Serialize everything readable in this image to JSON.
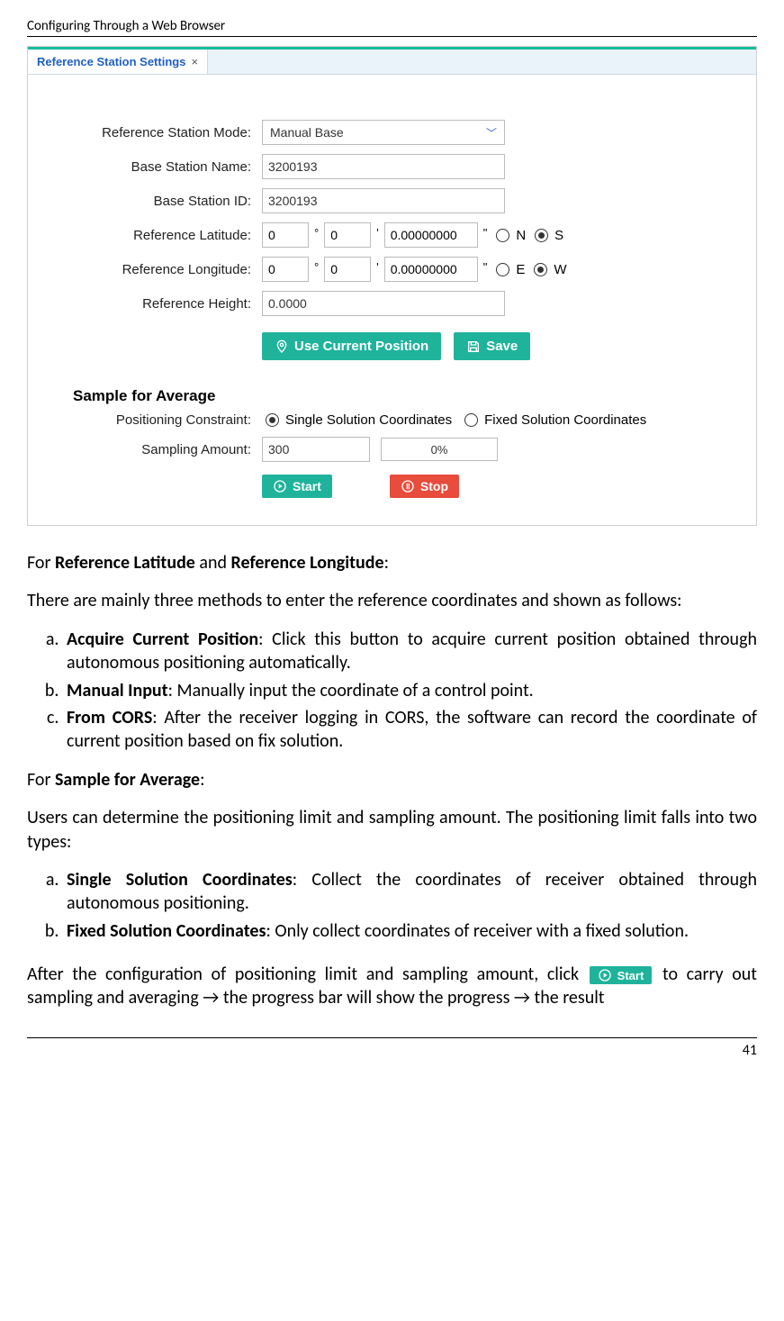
{
  "header": "Configuring Through a Web Browser",
  "page_number": "41",
  "screenshot": {
    "tab_label": "Reference Station Settings",
    "labels": {
      "mode": "Reference Station Mode:",
      "name": "Base Station Name:",
      "id": "Base Station ID:",
      "lat": "Reference Latitude:",
      "lon": "Reference Longitude:",
      "height": "Reference Height:",
      "constraint": "Positioning Constraint:",
      "amount": "Sampling Amount:"
    },
    "values": {
      "mode": "Manual Base",
      "name": "3200193",
      "id": "3200193",
      "lat_d": "0",
      "lat_m": "0",
      "lat_s": "0.00000000",
      "lon_d": "0",
      "lon_m": "0",
      "lon_s": "0.00000000",
      "height": "0.0000",
      "amount": "300",
      "progress": "0%"
    },
    "dir": {
      "n": "N",
      "s": "S",
      "e": "E",
      "w": "W"
    },
    "section_heading": "Sample for Average",
    "radios": {
      "single": "Single Solution Coordinates",
      "fixed": "Fixed Solution Coordinates"
    },
    "buttons": {
      "use_pos": "Use Current Position",
      "save": "Save",
      "start": "Start",
      "stop": "Stop"
    }
  },
  "text": {
    "p1_a": "For ",
    "p1_b": "Reference Latitude",
    "p1_c": " and ",
    "p1_d": "Reference Longitude",
    "p1_e": ":",
    "p2": "There are mainly three methods to enter the reference coordinates and shown as follows:",
    "li1_b": "Acquire Current Position",
    "li1_t": ": Click this button to acquire current position obtained through autonomous positioning automatically.",
    "li2_b": "Manual Input",
    "li2_t": ": Manually input the coordinate of a control point.",
    "li3_b": "From CORS",
    "li3_t": ": After the receiver logging in CORS, the software can record the coordinate of current position based on fix solution.",
    "p3_a": "For ",
    "p3_b": "Sample for Average",
    "p3_c": ":",
    "p4": "Users can determine the positioning limit and sampling amount. The positioning limit falls into two types:",
    "li4_b": "Single Solution Coordinates",
    "li4_t": ": Collect the coordinates of receiver obtained through autonomous positioning.",
    "li5_b": "Fixed Solution Coordinates",
    "li5_t": ": Only collect coordinates of receiver with a fixed solution.",
    "p5_a": "After the configuration of positioning limit and sampling amount, click ",
    "p5_b": " to carry out sampling and averaging → the progress bar will show the progress → the result"
  }
}
